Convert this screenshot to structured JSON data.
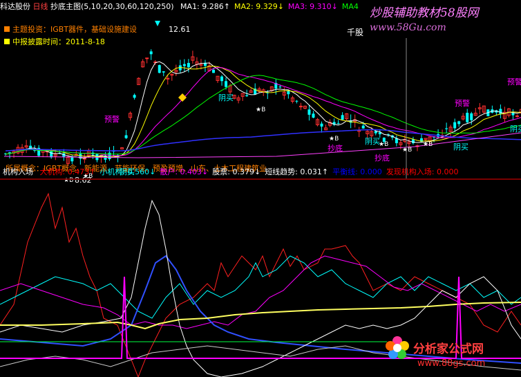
{
  "top_header": {
    "stock_name": "科达股份",
    "period": "日线",
    "indicator_name": "抄底主图",
    "params": "(5,10,20,30,60,120,250)",
    "ma_items": [
      {
        "label": "MA1:",
        "value": "9.286↑",
        "color": "#ffffff"
      },
      {
        "label": "MA2:",
        "value": "9.329↓",
        "color": "#ffff00"
      },
      {
        "label": "MA3:",
        "value": "9.310↓",
        "color": "#ff00ff"
      },
      {
        "label": "MA4",
        "value": "",
        "color": "#00ff00"
      }
    ]
  },
  "info_box": {
    "theme": "主题投资：IGBT器件，基础设施建设",
    "report_date": "中报披露时间：2011-8-18",
    "theme_color": "#ff8000",
    "report_color": "#ffff00"
  },
  "price_chart": {
    "high_label": "12.61",
    "low_label": "8.62",
    "qiangu_label": "千股",
    "concept_text": "所属概念：IGBT概念、新能源、节能环保、预盈预增、山东、土木工程建筑业",
    "signals": [
      {
        "text": "预警",
        "color": "#ff00ff"
      },
      {
        "text": "阴买",
        "color": "#00ffff"
      },
      {
        "text": "阴买",
        "color": "#00ffff"
      },
      {
        "text": "抄底",
        "color": "#ff00ff"
      },
      {
        "text": "阴买",
        "color": "#00ffff"
      },
      {
        "text": "抄底",
        "color": "#ff00ff"
      },
      {
        "text": "预警",
        "color": "#ff00ff"
      },
      {
        "text": "阴买",
        "color": "#00ffff"
      },
      {
        "text": "阴买",
        "color": "#00ffff"
      },
      {
        "text": "预警",
        "color": "#ff00ff"
      }
    ],
    "star_label": "★B"
  },
  "lower_header": {
    "indicator_name": "机构入场",
    "items": [
      {
        "label": "大机构:",
        "value": "0.473↑",
        "color": "#ff0000"
      },
      {
        "label": "小机构:",
        "value": "0.560↓",
        "color": "#00ffff"
      },
      {
        "label": "散户:",
        "value": "0.403↓",
        "color": "#ff00ff"
      },
      {
        "label": "股票:",
        "value": "0.379↓",
        "color": "#ffffff"
      },
      {
        "label": "短线趋势:",
        "value": "0.031↑",
        "color": "#ffffff"
      },
      {
        "label": "平衡线:",
        "value": "0.000",
        "color": "#0000ff"
      },
      {
        "label": "发现机构入场:",
        "value": "0.000",
        "color": "#ff0000"
      }
    ]
  },
  "watermarks": {
    "top": "炒股辅助教材58股网",
    "top_url": "www.58Gu.com",
    "bottom": "分析家公式网",
    "bottom_url": "www.88gs.com"
  },
  "colors": {
    "up_candle": "#ff3030",
    "down_candle": "#00ffff",
    "ma_white": "#ffffff",
    "ma_yellow": "#ffff00",
    "ma_magenta": "#ff00ff",
    "ma_green": "#00ff00",
    "ma_blue": "#3030ff",
    "balance_line": "#ffff60"
  },
  "chart_data": [
    {
      "type": "candlestick",
      "title": "抄底主图",
      "price_high": 12.61,
      "price_low": 8.62,
      "moving_averages": [
        "MA1",
        "MA2",
        "MA3",
        "MA4"
      ],
      "latest": {
        "MA1": 9.286,
        "MA2": 9.329,
        "MA3": 9.31
      }
    },
    {
      "type": "line",
      "title": "机构入场",
      "series": [
        {
          "name": "大机构",
          "latest": 0.473
        },
        {
          "name": "小机构",
          "latest": 0.56
        },
        {
          "name": "散户",
          "latest": 0.403
        },
        {
          "name": "股票",
          "latest": 0.379
        },
        {
          "name": "短线趋势",
          "latest": 0.031
        },
        {
          "name": "平衡线",
          "latest": 0.0
        },
        {
          "name": "发现机构入场",
          "latest": 0.0
        }
      ]
    }
  ]
}
